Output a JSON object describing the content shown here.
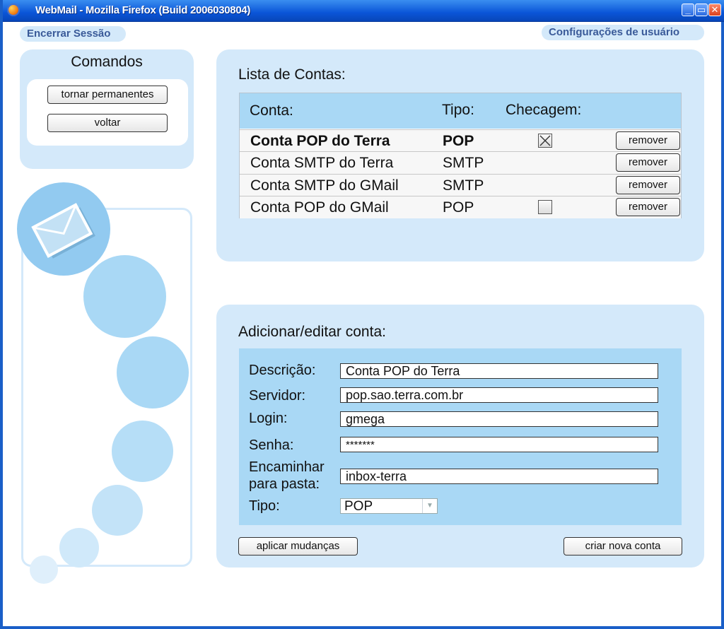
{
  "window": {
    "title": "WebMail - Mozilla Firefox (Build 2006030804)",
    "minimize_label": "_",
    "maximize_label": "▭",
    "close_label": "✕"
  },
  "top_links": {
    "logout": "Encerrar Sessão",
    "user_settings": "Configurações de usuário"
  },
  "commands": {
    "title": "Comandos",
    "make_permanent": "tornar permanentes",
    "back": "voltar"
  },
  "accounts": {
    "title": "Lista de Contas:",
    "columns": {
      "account": "Conta:",
      "type": "Tipo:",
      "check": "Checagem:"
    },
    "rows": [
      {
        "name": "Conta POP do Terra",
        "type": "POP",
        "check": "checked",
        "bold": true,
        "remove": "remover"
      },
      {
        "name": "Conta SMTP do Terra",
        "type": "SMTP",
        "check": "none",
        "bold": false,
        "remove": "remover"
      },
      {
        "name": "Conta SMTP do GMail",
        "type": "SMTP",
        "check": "none",
        "bold": false,
        "remove": "remover"
      },
      {
        "name": "Conta POP do GMail",
        "type": "POP",
        "check": "unchecked",
        "bold": false,
        "remove": "remover"
      }
    ]
  },
  "edit": {
    "title": "Adicionar/editar conta:",
    "description_label": "Descrição:",
    "description_value": "Conta POP do Terra",
    "server_label": "Servidor:",
    "server_value": "pop.sao.terra.com.br",
    "login_label": "Login:",
    "login_value": "gmega",
    "password_label": "Senha:",
    "password_value": "*******",
    "forward_label_line1": "Encaminhar",
    "forward_label_line2": "para pasta:",
    "forward_value": "inbox-terra",
    "type_label": "Tipo:",
    "type_value": "POP",
    "type_arrow": "▼",
    "apply_button": "aplicar mudanças",
    "new_button": "criar nova conta"
  },
  "colors": {
    "panel": "#d4e9fa",
    "table_header": "#a9d8f5",
    "titlebar": "#0a55d8",
    "circle": "#a9d8f5"
  },
  "decoration": {
    "icon": "envelope-icon"
  }
}
